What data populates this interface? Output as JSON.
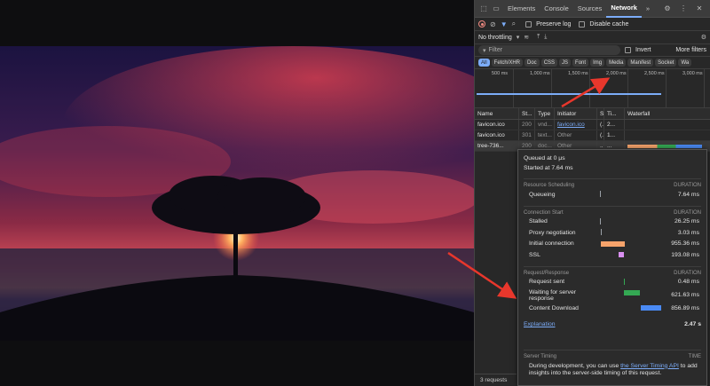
{
  "devtools": {
    "tabs": [
      {
        "label": "Elements"
      },
      {
        "label": "Console"
      },
      {
        "label": "Sources"
      },
      {
        "label": "Network"
      }
    ],
    "more_tabs": "»",
    "toolbar": {
      "preserve_log": "Preserve log",
      "disable_cache": "Disable cache",
      "throttling": "No throttling"
    },
    "filter": {
      "placeholder": "Filter",
      "invert": "Invert",
      "more_filters": "More filters"
    },
    "type_filters": [
      "All",
      "Fetch/XHR",
      "Doc",
      "CSS",
      "JS",
      "Font",
      "Img",
      "Media",
      "Manifest",
      "Socket",
      "Wa"
    ],
    "overview_ticks": [
      "500 ms",
      "1,000 ms",
      "1,500 ms",
      "2,000 ms",
      "2,500 ms",
      "3,000 ms"
    ],
    "table": {
      "headers": [
        "Name",
        "St...",
        "Type",
        "Initiator",
        "S",
        "Ti...",
        "Waterfall"
      ],
      "rows": [
        {
          "name": "favicon.ico",
          "status": "200",
          "type": "vnd...",
          "initiator": "favicon.ico",
          "size": "(...",
          "time": "2..."
        },
        {
          "name": "favicon.ico",
          "status": "301",
          "type": "text...",
          "initiator": "Other",
          "size": "(...",
          "time": "1..."
        },
        {
          "name": "tree-736...",
          "status": "200",
          "type": "doc...",
          "initiator": "Other",
          "size": "...",
          "time": "..."
        }
      ]
    },
    "status_bar": "3 requests"
  },
  "timing": {
    "queued": "Queued at 0 μs",
    "started": "Started at 7.64 ms",
    "duration_label": "DURATION",
    "sections": [
      {
        "title": "Resource Scheduling",
        "rows": [
          {
            "label": "Queueing",
            "value": "7.64 ms",
            "color": "#9aa0a6",
            "start": 0.0,
            "len": 0.3
          }
        ]
      },
      {
        "title": "Connection Start",
        "rows": [
          {
            "label": "Stalled",
            "value": "26.25 ms",
            "color": "#9aa0a6",
            "start": 0.0,
            "len": 0.3
          },
          {
            "label": "Proxy negotiation",
            "value": "3.03 ms",
            "color": "#9aa0a6",
            "start": 0.02,
            "len": 0.1
          },
          {
            "label": "Initial connection",
            "value": "955.36 ms",
            "color": "#f6a36b",
            "start": 0.02,
            "len": 38
          },
          {
            "label": "SSL",
            "value": "193.08 ms",
            "color": "#d98ff0",
            "start": 0.3,
            "len": 8
          }
        ]
      },
      {
        "title": "Request/Response",
        "rows": [
          {
            "label": "Request sent",
            "value": "0.48 ms",
            "color": "#34a853",
            "start": 0.39,
            "len": 0.3
          },
          {
            "label": "Waiting for server response",
            "value": "621.63 ms",
            "color": "#34a853",
            "start": 0.39,
            "len": 25
          },
          {
            "label": "Content Download",
            "value": "856.89 ms",
            "color": "#4a8af4",
            "start": 0.65,
            "len": 34
          }
        ]
      }
    ],
    "explanation": "Explanation",
    "total": "2.47 s",
    "server_timing_title": "Server Timing",
    "server_timing_col": "TIME",
    "server_timing_text_before": "During development, you can use ",
    "server_timing_link": "the Server Timing API",
    "server_timing_text_after": " to add insights into the server-side timing of this request."
  }
}
